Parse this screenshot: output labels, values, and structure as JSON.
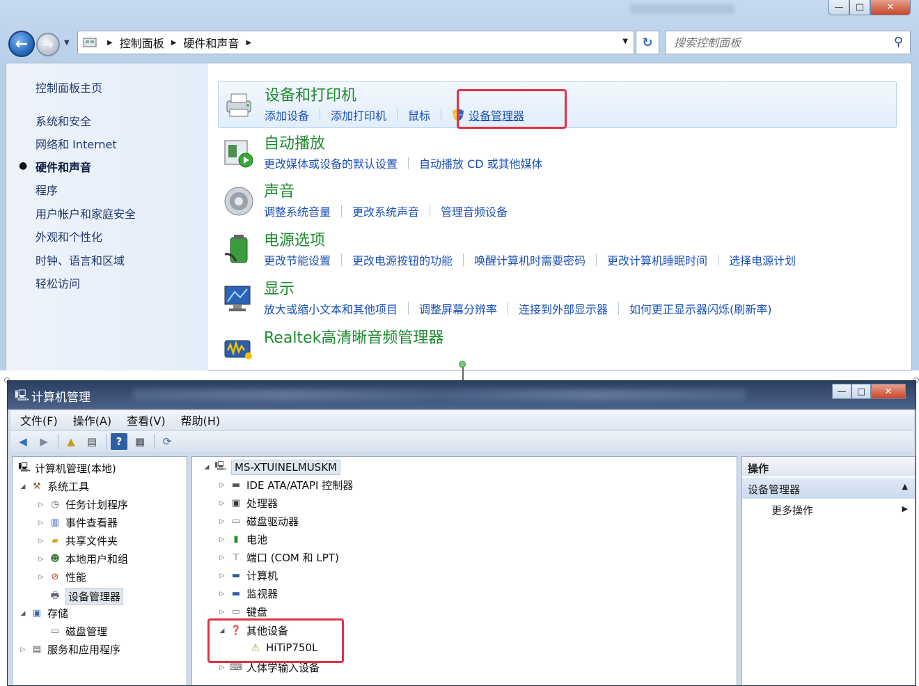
{
  "control_panel": {
    "window_buttons": {
      "minimize": "—",
      "maximize": "□",
      "close": "✕"
    },
    "address": {
      "icon": "control-panel-icon",
      "crumbs": [
        "控制面板",
        "硬件和声音"
      ]
    },
    "search": {
      "placeholder": "搜索控制面板",
      "icon": "search-icon"
    },
    "sidebar": {
      "home": "控制面板主页",
      "categories": [
        {
          "label": "系统和安全",
          "active": false
        },
        {
          "label": "网络和 Internet",
          "active": false
        },
        {
          "label": "硬件和声音",
          "active": true
        },
        {
          "label": "程序",
          "active": false
        },
        {
          "label": "用户帐户和家庭安全",
          "active": false
        },
        {
          "label": "外观和个性化",
          "active": false
        },
        {
          "label": "时钟、语言和区域",
          "active": false
        },
        {
          "label": "轻松访问",
          "active": false
        }
      ]
    },
    "items": [
      {
        "title": "设备和打印机",
        "icon": "printer-icon",
        "links": [
          "添加设备",
          "添加打印机",
          "鼠标",
          "设备管理器"
        ]
      },
      {
        "title": "自动播放",
        "icon": "autoplay-icon",
        "links": [
          "更改媒体或设备的默认设置",
          "自动播放 CD 或其他媒体"
        ]
      },
      {
        "title": "声音",
        "icon": "speaker-icon",
        "links": [
          "调整系统音量",
          "更改系统声音",
          "管理音频设备"
        ]
      },
      {
        "title": "电源选项",
        "icon": "battery-icon",
        "links": [
          "更改节能设置",
          "更改电源按钮的功能",
          "唤醒计算机时需要密码",
          "更改计算机睡眠时间",
          "选择电源计划"
        ]
      },
      {
        "title": "显示",
        "icon": "monitor-icon",
        "links": [
          "放大或缩小文本和其他项目",
          "调整屏幕分辨率",
          "连接到外部显示器",
          "如何更正显示器闪烁(刷新率)"
        ]
      },
      {
        "title": "Realtek高清晰音频管理器",
        "icon": "audio-manager-icon",
        "links": []
      }
    ],
    "colors": {
      "title_green": "#1e8a2f",
      "link_blue": "#1a50b8",
      "highlight_red": "#e03244"
    }
  },
  "computer_management": {
    "title": "计算机管理",
    "window_buttons": {
      "minimize": "—",
      "maximize": "□",
      "close": "✕"
    },
    "menu": [
      "文件(F)",
      "操作(A)",
      "查看(V)",
      "帮助(H)"
    ],
    "toolbar_icons": [
      "back-arrow-icon",
      "forward-arrow-icon",
      "up-folder-icon",
      "show-tree-icon",
      "help-icon",
      "properties-icon",
      "scan-hardware-icon"
    ],
    "tree": {
      "root": "计算机管理(本地)",
      "system_tools": "系统工具",
      "task_scheduler": "任务计划程序",
      "event_viewer": "事件查看器",
      "shared_folders": "共享文件夹",
      "local_users": "本地用户和组",
      "performance": "性能",
      "device_manager": "设备管理器",
      "storage": "存储",
      "disk_management": "磁盘管理",
      "services_apps": "服务和应用程序"
    },
    "devices": {
      "computer_name": "MS-XTUINELMUSKM",
      "categories": [
        {
          "label": "IDE ATA/ATAPI 控制器",
          "icon": "ide-controller-icon"
        },
        {
          "label": "处理器",
          "icon": "processor-icon"
        },
        {
          "label": "磁盘驱动器",
          "icon": "disk-drive-icon"
        },
        {
          "label": "电池",
          "icon": "battery-icon"
        },
        {
          "label": "端口 (COM 和 LPT)",
          "icon": "port-icon"
        },
        {
          "label": "计算机",
          "icon": "computer-icon"
        },
        {
          "label": "监视器",
          "icon": "monitor-icon"
        },
        {
          "label": "键盘",
          "icon": "keyboard-icon"
        }
      ],
      "other_devices": "其他设备",
      "unknown_device": "HiTiP750L",
      "after": {
        "label": "人体学输入设备",
        "icon": "hid-icon"
      }
    },
    "actions": {
      "header": "操作",
      "section": "设备管理器",
      "more": "更多操作"
    }
  }
}
